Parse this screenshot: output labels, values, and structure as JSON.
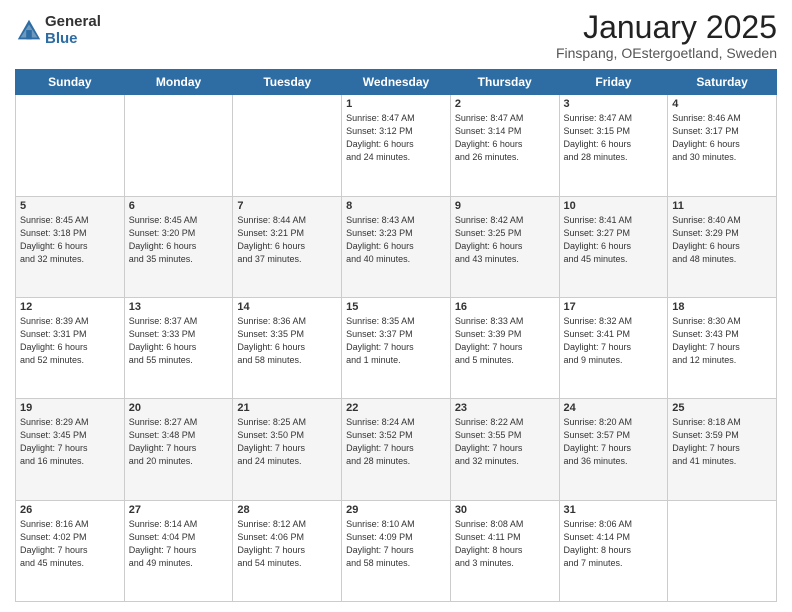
{
  "logo": {
    "general": "General",
    "blue": "Blue"
  },
  "title": "January 2025",
  "location": "Finspang, OEstergoetland, Sweden",
  "days_of_week": [
    "Sunday",
    "Monday",
    "Tuesday",
    "Wednesday",
    "Thursday",
    "Friday",
    "Saturday"
  ],
  "weeks": [
    [
      {
        "day": "",
        "info": ""
      },
      {
        "day": "",
        "info": ""
      },
      {
        "day": "",
        "info": ""
      },
      {
        "day": "1",
        "info": "Sunrise: 8:47 AM\nSunset: 3:12 PM\nDaylight: 6 hours\nand 24 minutes."
      },
      {
        "day": "2",
        "info": "Sunrise: 8:47 AM\nSunset: 3:14 PM\nDaylight: 6 hours\nand 26 minutes."
      },
      {
        "day": "3",
        "info": "Sunrise: 8:47 AM\nSunset: 3:15 PM\nDaylight: 6 hours\nand 28 minutes."
      },
      {
        "day": "4",
        "info": "Sunrise: 8:46 AM\nSunset: 3:17 PM\nDaylight: 6 hours\nand 30 minutes."
      }
    ],
    [
      {
        "day": "5",
        "info": "Sunrise: 8:45 AM\nSunset: 3:18 PM\nDaylight: 6 hours\nand 32 minutes."
      },
      {
        "day": "6",
        "info": "Sunrise: 8:45 AM\nSunset: 3:20 PM\nDaylight: 6 hours\nand 35 minutes."
      },
      {
        "day": "7",
        "info": "Sunrise: 8:44 AM\nSunset: 3:21 PM\nDaylight: 6 hours\nand 37 minutes."
      },
      {
        "day": "8",
        "info": "Sunrise: 8:43 AM\nSunset: 3:23 PM\nDaylight: 6 hours\nand 40 minutes."
      },
      {
        "day": "9",
        "info": "Sunrise: 8:42 AM\nSunset: 3:25 PM\nDaylight: 6 hours\nand 43 minutes."
      },
      {
        "day": "10",
        "info": "Sunrise: 8:41 AM\nSunset: 3:27 PM\nDaylight: 6 hours\nand 45 minutes."
      },
      {
        "day": "11",
        "info": "Sunrise: 8:40 AM\nSunset: 3:29 PM\nDaylight: 6 hours\nand 48 minutes."
      }
    ],
    [
      {
        "day": "12",
        "info": "Sunrise: 8:39 AM\nSunset: 3:31 PM\nDaylight: 6 hours\nand 52 minutes."
      },
      {
        "day": "13",
        "info": "Sunrise: 8:37 AM\nSunset: 3:33 PM\nDaylight: 6 hours\nand 55 minutes."
      },
      {
        "day": "14",
        "info": "Sunrise: 8:36 AM\nSunset: 3:35 PM\nDaylight: 6 hours\nand 58 minutes."
      },
      {
        "day": "15",
        "info": "Sunrise: 8:35 AM\nSunset: 3:37 PM\nDaylight: 7 hours\nand 1 minute."
      },
      {
        "day": "16",
        "info": "Sunrise: 8:33 AM\nSunset: 3:39 PM\nDaylight: 7 hours\nand 5 minutes."
      },
      {
        "day": "17",
        "info": "Sunrise: 8:32 AM\nSunset: 3:41 PM\nDaylight: 7 hours\nand 9 minutes."
      },
      {
        "day": "18",
        "info": "Sunrise: 8:30 AM\nSunset: 3:43 PM\nDaylight: 7 hours\nand 12 minutes."
      }
    ],
    [
      {
        "day": "19",
        "info": "Sunrise: 8:29 AM\nSunset: 3:45 PM\nDaylight: 7 hours\nand 16 minutes."
      },
      {
        "day": "20",
        "info": "Sunrise: 8:27 AM\nSunset: 3:48 PM\nDaylight: 7 hours\nand 20 minutes."
      },
      {
        "day": "21",
        "info": "Sunrise: 8:25 AM\nSunset: 3:50 PM\nDaylight: 7 hours\nand 24 minutes."
      },
      {
        "day": "22",
        "info": "Sunrise: 8:24 AM\nSunset: 3:52 PM\nDaylight: 7 hours\nand 28 minutes."
      },
      {
        "day": "23",
        "info": "Sunrise: 8:22 AM\nSunset: 3:55 PM\nDaylight: 7 hours\nand 32 minutes."
      },
      {
        "day": "24",
        "info": "Sunrise: 8:20 AM\nSunset: 3:57 PM\nDaylight: 7 hours\nand 36 minutes."
      },
      {
        "day": "25",
        "info": "Sunrise: 8:18 AM\nSunset: 3:59 PM\nDaylight: 7 hours\nand 41 minutes."
      }
    ],
    [
      {
        "day": "26",
        "info": "Sunrise: 8:16 AM\nSunset: 4:02 PM\nDaylight: 7 hours\nand 45 minutes."
      },
      {
        "day": "27",
        "info": "Sunrise: 8:14 AM\nSunset: 4:04 PM\nDaylight: 7 hours\nand 49 minutes."
      },
      {
        "day": "28",
        "info": "Sunrise: 8:12 AM\nSunset: 4:06 PM\nDaylight: 7 hours\nand 54 minutes."
      },
      {
        "day": "29",
        "info": "Sunrise: 8:10 AM\nSunset: 4:09 PM\nDaylight: 7 hours\nand 58 minutes."
      },
      {
        "day": "30",
        "info": "Sunrise: 8:08 AM\nSunset: 4:11 PM\nDaylight: 8 hours\nand 3 minutes."
      },
      {
        "day": "31",
        "info": "Sunrise: 8:06 AM\nSunset: 4:14 PM\nDaylight: 8 hours\nand 7 minutes."
      },
      {
        "day": "",
        "info": ""
      }
    ]
  ]
}
